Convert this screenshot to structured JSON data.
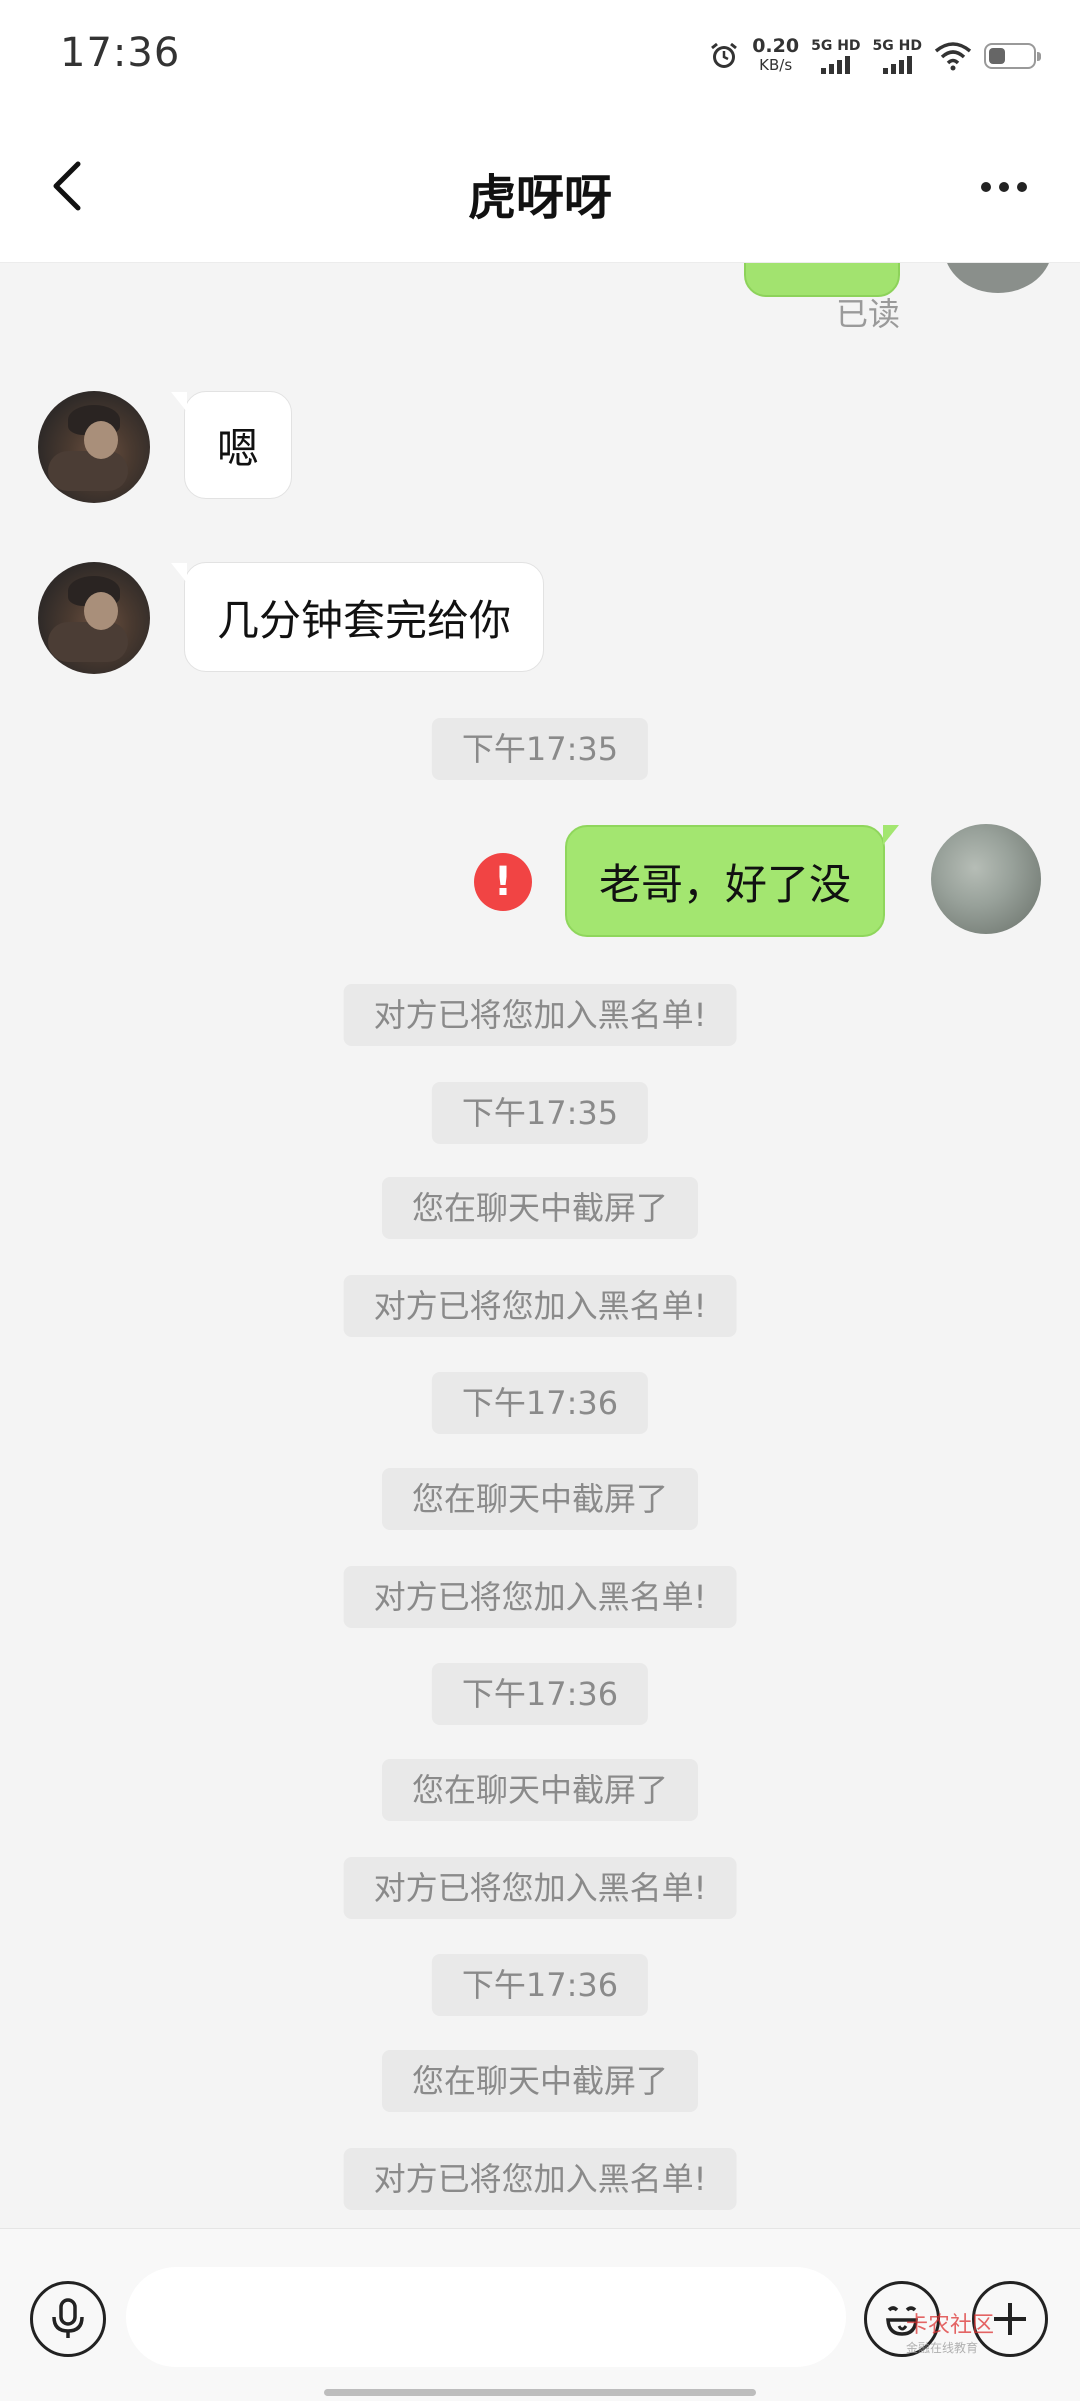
{
  "status_bar": {
    "time": "17:36",
    "net_speed_value": "0.20",
    "net_speed_unit": "KB/s",
    "sim1_label": "5G HD",
    "sim2_label": "5G HD"
  },
  "header": {
    "title": "虎呀呀"
  },
  "chat": {
    "read_status": "已读",
    "messages": [
      {
        "side": "left",
        "text": "嗯"
      },
      {
        "side": "left",
        "text": "几分钟套完给你"
      },
      {
        "type": "time",
        "text": "下午17:35"
      },
      {
        "side": "right",
        "text": "老哥，好了没",
        "error_mark": "!"
      },
      {
        "type": "system",
        "text": "对方已将您加入黑名单!"
      },
      {
        "type": "time",
        "text": "下午17:35"
      },
      {
        "type": "system",
        "text": "您在聊天中截屏了"
      },
      {
        "type": "system",
        "text": "对方已将您加入黑名单!"
      },
      {
        "type": "time",
        "text": "下午17:36"
      },
      {
        "type": "system",
        "text": "您在聊天中截屏了"
      },
      {
        "type": "system",
        "text": "对方已将您加入黑名单!"
      },
      {
        "type": "time",
        "text": "下午17:36"
      },
      {
        "type": "system",
        "text": "您在聊天中截屏了"
      },
      {
        "type": "system",
        "text": "对方已将您加入黑名单!"
      },
      {
        "type": "time",
        "text": "下午17:36"
      },
      {
        "type": "system",
        "text": "您在聊天中截屏了"
      },
      {
        "type": "system",
        "text": "对方已将您加入黑名单!"
      }
    ]
  },
  "input_bar": {
    "message_value": "",
    "watermark_text": "卡农社区",
    "watermark_sub": "金融在线教育"
  },
  "icons": {
    "back": "chevron-left-icon",
    "more": "more-dots-icon",
    "voice": "microphone-icon",
    "emoji": "emoji-icon",
    "plus": "plus-icon",
    "error": "error-exclamation-icon"
  }
}
